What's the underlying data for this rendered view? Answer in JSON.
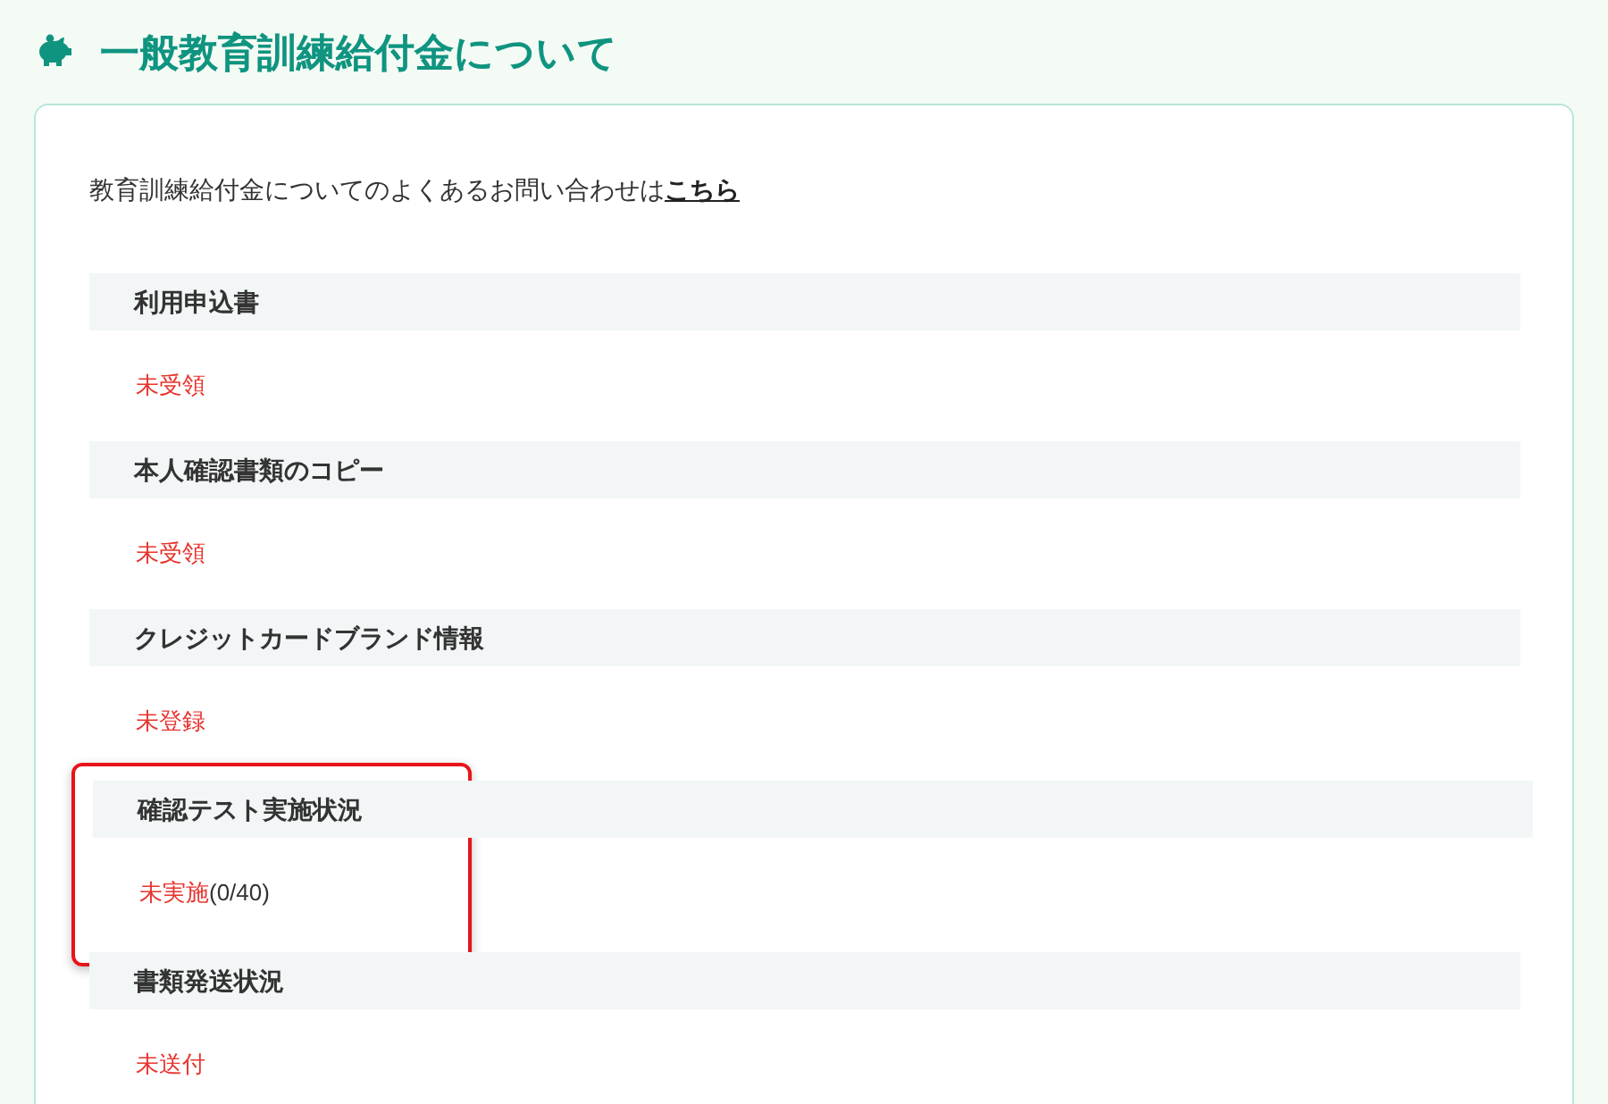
{
  "page_title": "一般教育訓練給付金について",
  "intro": {
    "text": "教育訓練給付金についてのよくあるお問い合わせは",
    "link": "こちら"
  },
  "items": [
    {
      "label": "利用申込書",
      "status": "未受領",
      "highlighted": false
    },
    {
      "label": "本人確認書類のコピー",
      "status": "未受領",
      "highlighted": false
    },
    {
      "label": "クレジットカードブランド情報",
      "status": "未登録",
      "highlighted": false
    },
    {
      "label": "確認テスト実施状況",
      "status": "未実施",
      "detail": "(0/40)",
      "highlighted": true
    },
    {
      "label": "書類発送状況",
      "status": "未送付",
      "highlighted": false
    }
  ]
}
